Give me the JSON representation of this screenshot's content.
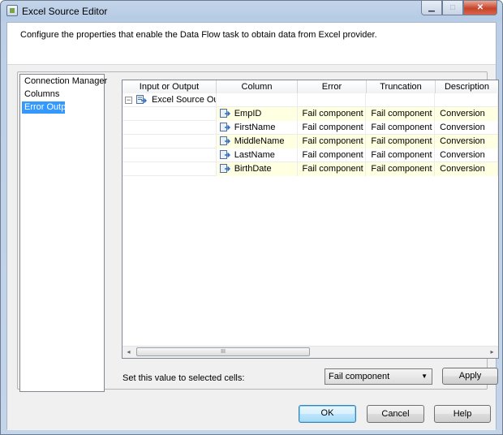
{
  "window": {
    "title": "Excel Source Editor",
    "controls": {
      "minimize": "▁",
      "maximize": "□",
      "close": "✕"
    }
  },
  "header": {
    "description": "Configure the properties that enable the Data Flow task to obtain data from Excel provider."
  },
  "nav": {
    "items": [
      {
        "label": "Connection Manager",
        "selected": false
      },
      {
        "label": "Columns",
        "selected": false
      },
      {
        "label": "Error Output",
        "selected": true
      }
    ]
  },
  "grid": {
    "columns": [
      "Input or Output",
      "Column",
      "Error",
      "Truncation",
      "Description"
    ],
    "group": {
      "toggle": "−",
      "label": "Excel Source Out..."
    },
    "rows": [
      {
        "column": "EmpID",
        "error": "Fail component",
        "truncation": "Fail component",
        "description": "Conversion"
      },
      {
        "column": "FirstName",
        "error": "Fail component",
        "truncation": "Fail component",
        "description": "Conversion"
      },
      {
        "column": "MiddleName",
        "error": "Fail component",
        "truncation": "Fail component",
        "description": "Conversion"
      },
      {
        "column": "LastName",
        "error": "Fail component",
        "truncation": "Fail component",
        "description": "Conversion"
      },
      {
        "column": "BirthDate",
        "error": "Fail component",
        "truncation": "Fail component",
        "description": "Conversion"
      }
    ],
    "scrollbar": {
      "left_arrow": "◂",
      "right_arrow": "▸",
      "grip": "III"
    }
  },
  "set_value": {
    "label": "Set this value to selected cells:",
    "selected": "Fail component",
    "arrow": "▼",
    "apply_label": "Apply"
  },
  "footer": {
    "ok_label": "OK",
    "cancel_label": "Cancel",
    "help_label": "Help"
  },
  "colors": {
    "selection": "#3399ff",
    "row_highlight": "#ffffe1",
    "title_bar": "#bccfe7"
  }
}
